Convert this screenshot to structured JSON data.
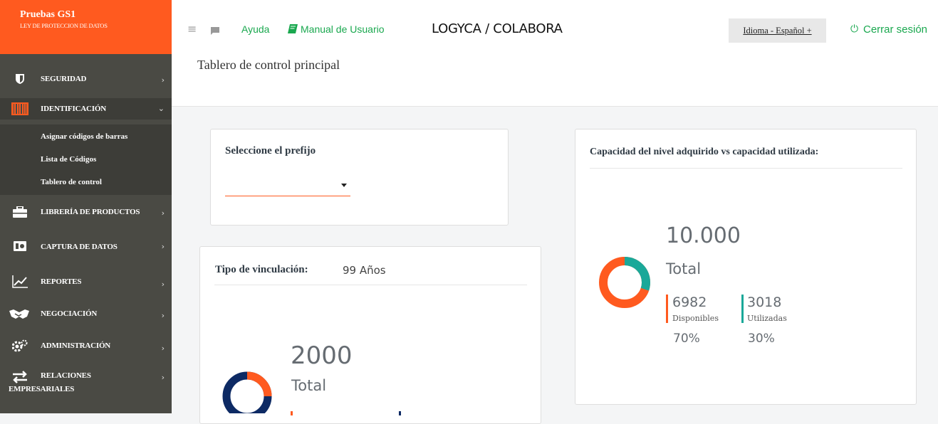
{
  "brand": {
    "title": "Pruebas GS1",
    "subtitle": "LEY DE PROTECCION DE DATOS"
  },
  "topbar": {
    "help": "Ayuda",
    "manual": "Manual de Usuario",
    "app_title": "LOGYCA / COLABORA",
    "language": "Idioma - Español +",
    "logout": "Cerrar sesión"
  },
  "sidebar": {
    "items": [
      {
        "label": "SEGURIDAD",
        "icon": "shield-icon",
        "chevron": "›"
      },
      {
        "label": "IDENTIFICACIÓN",
        "icon": "barcode-icon",
        "chevron": "⌄"
      },
      {
        "label": "LIBRERÍA DE PRODUCTOS",
        "icon": "briefcase-icon",
        "chevron": "›"
      },
      {
        "label": "CAPTURA DE DATOS",
        "icon": "data-capture-icon",
        "chevron": "›"
      },
      {
        "label": "REPORTES",
        "icon": "chart-icon",
        "chevron": "›"
      },
      {
        "label": "NEGOCIACIÓN",
        "icon": "handshake-icon",
        "chevron": "›"
      },
      {
        "label": "ADMINISTRACIÓN",
        "icon": "gears-icon",
        "chevron": "›"
      },
      {
        "label": "RELACIONES",
        "label2": "EMPRESARIALES",
        "icon": "exchange-icon",
        "chevron": "›"
      }
    ],
    "submenu": [
      "Asignar códigos de barras",
      "Lista de Códigos",
      "Tablero de control"
    ]
  },
  "page": {
    "title": "Tablero de control principal"
  },
  "prefix_card": {
    "title": "Seleccione el prefijo",
    "selected": ""
  },
  "link_card": {
    "title": "Tipo de vinculación:",
    "value": "99 Años",
    "total_number": "2000",
    "total_label": "Total"
  },
  "capacity_card": {
    "title": "Capacidad del nivel adquirido vs capacidad utilizada:",
    "total_number": "10.000",
    "total_label": "Total",
    "available": {
      "value": "6982",
      "label": "Disponibles",
      "percent": "70%"
    },
    "used": {
      "value": "3018",
      "label": "Utilizadas",
      "percent": "30%"
    }
  },
  "colors": {
    "accent": "#ff5a1f",
    "teal": "#1aa899",
    "navy": "#0d2a64",
    "sidebar": "#4a4a44",
    "link": "#1aa84f"
  },
  "donut_fractions": {
    "capacity_available": 0.6982,
    "capacity_used": 0.3018
  }
}
